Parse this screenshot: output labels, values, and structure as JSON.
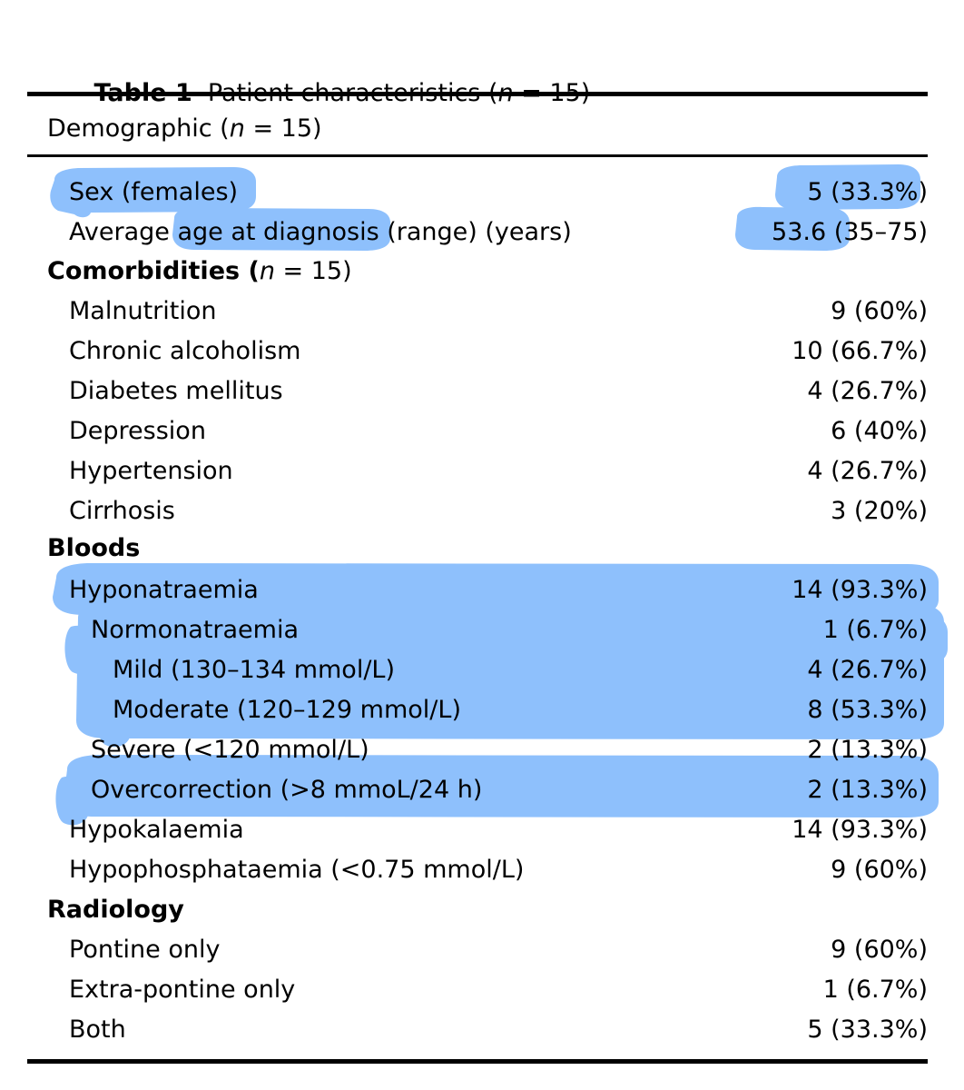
{
  "caption": {
    "label": "Table 1",
    "text": "Patient characteristics (",
    "n_italic": "n",
    "n_rest": " = 15)"
  },
  "colors": {
    "highlight": "#8EC0FC",
    "highlight_edge": "#7FB6FA",
    "text": "#000000",
    "rule": "#000000"
  },
  "sections": [
    {
      "id": "demographic",
      "header": {
        "label": "Demographic (",
        "italic": "n",
        "suffix": " = 15)"
      },
      "header_bold": false,
      "rows": [
        {
          "label": "Sex (females)",
          "value": "5 (33.3%)",
          "indent": 1,
          "highlight": "full"
        },
        {
          "label": "Average age at diagnosis (range) (years)",
          "value": "53.6 (35–75)",
          "indent": 1,
          "highlight": "partial"
        }
      ]
    },
    {
      "id": "comorbidities",
      "header": {
        "label": "Comorbidities (",
        "italic": "n",
        "suffix": " = 15)"
      },
      "header_bold": true,
      "rows": [
        {
          "label": "Malnutrition",
          "value": "9 (60%)",
          "indent": 1,
          "highlight": "none"
        },
        {
          "label": "Chronic alcoholism",
          "value": "10 (66.7%)",
          "indent": 1,
          "highlight": "none"
        },
        {
          "label": "Diabetes mellitus",
          "value": "4 (26.7%)",
          "indent": 1,
          "highlight": "none"
        },
        {
          "label": "Depression",
          "value": "6 (40%)",
          "indent": 1,
          "highlight": "none"
        },
        {
          "label": "Hypertension",
          "value": "4 (26.7%)",
          "indent": 1,
          "highlight": "none"
        },
        {
          "label": "Cirrhosis",
          "value": "3 (20%)",
          "indent": 1,
          "highlight": "none"
        }
      ]
    },
    {
      "id": "bloods",
      "header": {
        "label": "Bloods",
        "italic": "",
        "suffix": ""
      },
      "header_bold": true,
      "rows": [
        {
          "label": "Hyponatraemia",
          "value": "14 (93.3%)",
          "indent": 1,
          "highlight": "full"
        },
        {
          "label": "Normonatraemia",
          "value": "1 (6.7%)",
          "indent": 2,
          "highlight": "full"
        },
        {
          "label": "Mild (130–134 mmol/L)",
          "value": "4 (26.7%)",
          "indent": 3,
          "highlight": "full"
        },
        {
          "label": "Moderate (120–129 mmol/L)",
          "value": "8 (53.3%)",
          "indent": 3,
          "highlight": "full"
        },
        {
          "label": "Severe (<120 mmol/L)",
          "value": "2 (13.3%)",
          "indent": 2,
          "highlight": "none"
        },
        {
          "label": "Overcorrection (>8 mmoL/24 h)",
          "value": "2 (13.3%)",
          "indent": 2,
          "highlight": "full"
        },
        {
          "label": "Hypokalaemia",
          "value": "14 (93.3%)",
          "indent": 1,
          "highlight": "none"
        },
        {
          "label": "Hypophosphataemia (<0.75 mmol/L)",
          "value": "9 (60%)",
          "indent": 1,
          "highlight": "none"
        }
      ]
    },
    {
      "id": "radiology",
      "header": {
        "label": "Radiology",
        "italic": "",
        "suffix": ""
      },
      "header_bold": true,
      "rows": [
        {
          "label": "Pontine only",
          "value": "9 (60%)",
          "indent": 1,
          "highlight": "none"
        },
        {
          "label": "Extra-pontine only",
          "value": "1 (6.7%)",
          "indent": 1,
          "highlight": "none"
        },
        {
          "label": "Both",
          "value": "5 (33.3%)",
          "indent": 1,
          "highlight": "none"
        }
      ]
    }
  ]
}
